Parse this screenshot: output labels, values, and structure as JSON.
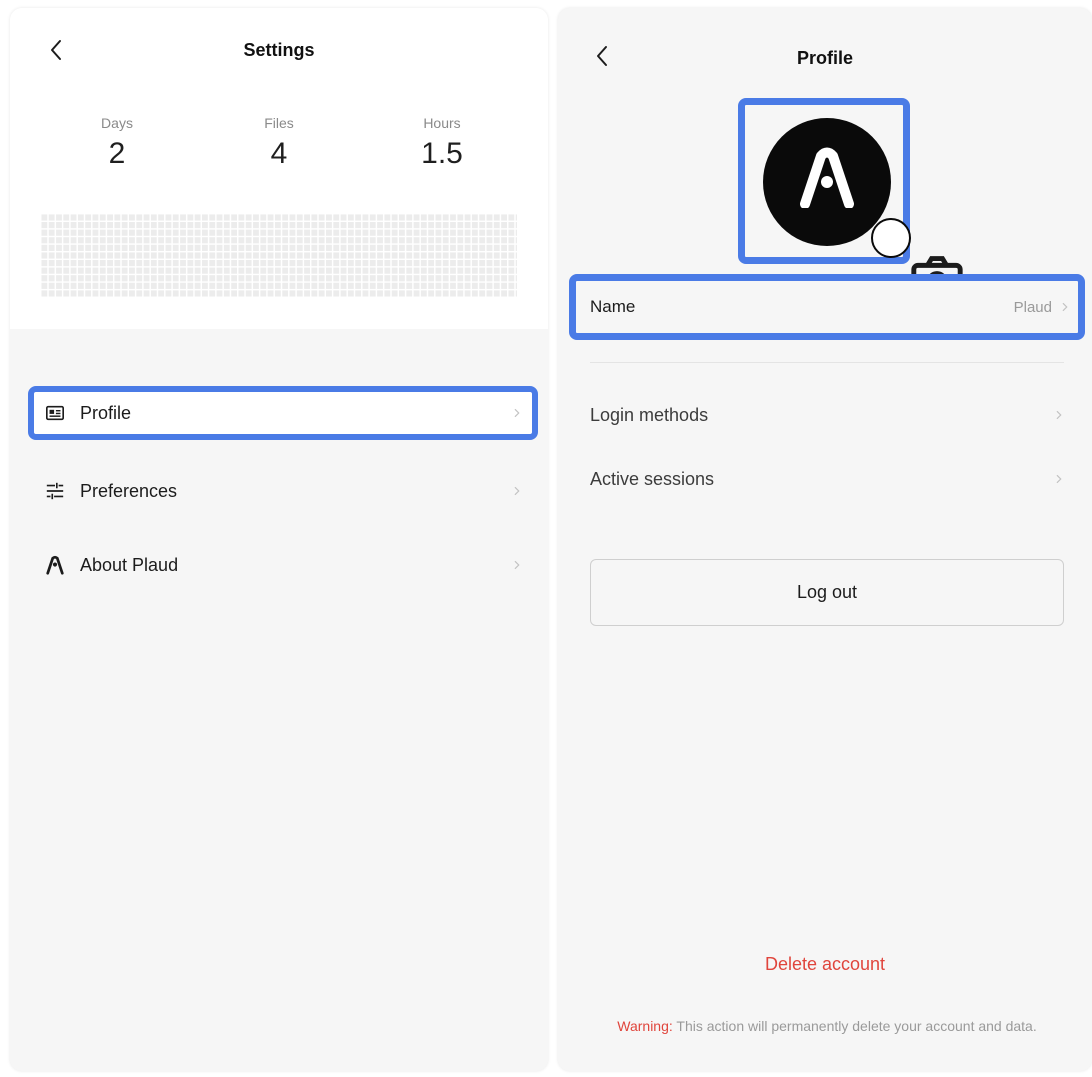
{
  "settings": {
    "title": "Settings",
    "stats": [
      {
        "label": "Days",
        "value": "2"
      },
      {
        "label": "Files",
        "value": "4"
      },
      {
        "label": "Hours",
        "value": "1.5"
      }
    ],
    "menu": [
      {
        "label": "Profile",
        "icon": "id-card-icon"
      },
      {
        "label": "Preferences",
        "icon": "sliders-icon"
      },
      {
        "label": "About Plaud",
        "icon": "plaud-logo-icon"
      }
    ]
  },
  "profile": {
    "title": "Profile",
    "avatar_icon": "plaud-logo-icon",
    "camera_icon": "camera-icon",
    "name_label": "Name",
    "name_value": "Plaud",
    "rows": [
      {
        "label": "Login methods"
      },
      {
        "label": "Active sessions"
      }
    ],
    "logout_label": "Log out",
    "delete_label": "Delete account",
    "warning_prefix": "Warning:",
    "warning_text": " This action will permanently delete your account and data."
  },
  "colors": {
    "highlight": "#4a7be6",
    "danger": "#e0453c",
    "panel_bg": "#f6f6f6"
  }
}
